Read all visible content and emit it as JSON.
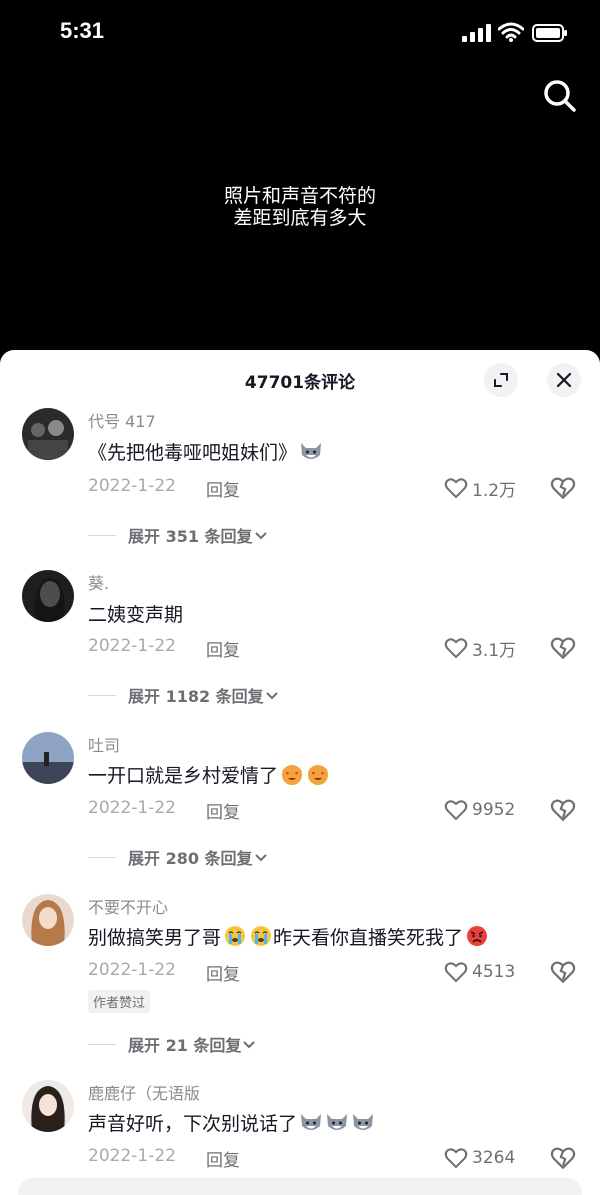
{
  "status": {
    "time": "5:31"
  },
  "video": {
    "caption_line1": "照片和声音不符的",
    "caption_line2": "差距到底有多大"
  },
  "sheet": {
    "title": "47701条评论"
  },
  "comments": [
    {
      "username": "代号 417",
      "text": "《先把他毒哑吧姐妹们》",
      "emojis": [
        "wolf-emoji"
      ],
      "date": "2022-1-22",
      "reply_label": "回复",
      "likes": "1.2万",
      "expand_label": "展开 351 条回复"
    },
    {
      "username": "葵.",
      "text": "二姨变声期",
      "emojis": [],
      "date": "2022-1-22",
      "reply_label": "回复",
      "likes": "3.1万",
      "expand_label": "展开 1182 条回复"
    },
    {
      "username": "吐司",
      "text": "一开口就是乡村爱情了",
      "emojis": [
        "heart-eyes-emoji",
        "heart-eyes-emoji"
      ],
      "date": "2022-1-22",
      "reply_label": "回复",
      "likes": "9952",
      "expand_label": "展开 280 条回复"
    },
    {
      "username": "不要不开心",
      "text_part1": "别做搞笑男了哥",
      "text_part2": "昨天看你直播笑死我了",
      "date": "2022-1-22",
      "reply_label": "回复",
      "likes": "4513",
      "author_badge": "作者赞过",
      "expand_label": "展开 21 条回复"
    },
    {
      "username": "鹿鹿仔（无语版",
      "text": "声音好听，下次别说话了",
      "emojis": [
        "wolf-emoji",
        "wolf-emoji",
        "wolf-emoji"
      ],
      "date": "2022-1-22",
      "reply_label": "回复",
      "likes": "3264"
    }
  ],
  "colors": {
    "accent_text": "#161823",
    "secondary_text": "#8a8b91",
    "sheet_bg": "#ffffff",
    "video_bg": "#000000"
  }
}
